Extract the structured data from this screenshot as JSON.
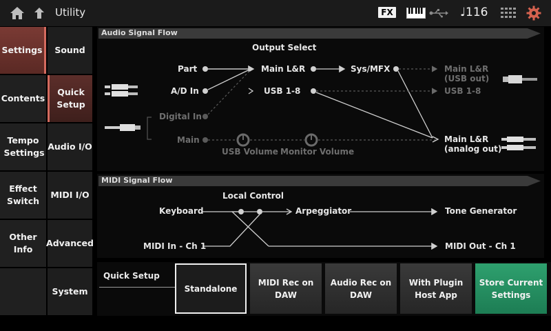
{
  "header": {
    "title": "Utility",
    "fx_badge": "FX",
    "tempo": "♩116",
    "icons": [
      "home-icon",
      "back-icon",
      "keyboard-icon",
      "usb-icon",
      "grid-icon",
      "gear-icon"
    ]
  },
  "nav": {
    "categories": [
      {
        "label": "Settings"
      },
      {
        "label": "Contents"
      },
      {
        "label": "Tempo Settings"
      },
      {
        "label": "Effect Switch"
      },
      {
        "label": "Other Info"
      }
    ],
    "subs": [
      {
        "label": "Sound"
      },
      {
        "label": "Quick Setup"
      },
      {
        "label": "Audio I/O"
      },
      {
        "label": "MIDI I/O"
      },
      {
        "label": "Advanced"
      },
      {
        "label": "System"
      }
    ]
  },
  "audio_flow": {
    "title": "Audio Signal Flow",
    "output_select": "Output Select",
    "part": "Part",
    "ad_in": "A/D In",
    "digital_in": "Digital In",
    "main": "Main",
    "main_lr": "Main L&R",
    "usb_1_8": "USB 1-8",
    "sys_mfx": "Sys/MFX",
    "main_lr_usb_out_1": "Main L&R",
    "main_lr_usb_out_2": "(USB out)",
    "usb_1_8_out": "USB 1-8",
    "main_lr_analog_1": "Main L&R",
    "main_lr_analog_2": "(analog out)",
    "usb_volume": "USB Volume",
    "monitor_volume": "Monitor Volume"
  },
  "midi_flow": {
    "title": "MIDI Signal Flow",
    "local_control": "Local Control",
    "keyboard": "Keyboard",
    "arpeggiator": "Arpeggiator",
    "tone_generator": "Tone Generator",
    "midi_in": "MIDI In - Ch 1",
    "midi_out": "MIDI Out - Ch 1"
  },
  "quick_setup": {
    "label": "Quick Setup",
    "buttons": [
      {
        "line1": "Standalone",
        "line2": ""
      },
      {
        "line1": "MIDI Rec on",
        "line2": "DAW"
      },
      {
        "line1": "Audio Rec on",
        "line2": "DAW"
      },
      {
        "line1": "With Plugin",
        "line2": "Host App"
      },
      {
        "line1": "Store Current",
        "line2": "Settings"
      }
    ]
  },
  "colors": {
    "accent_red": "#d46a5e",
    "store_green": "#2ea06e"
  }
}
